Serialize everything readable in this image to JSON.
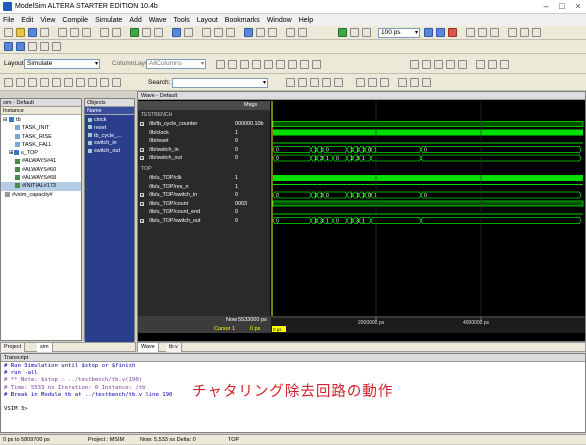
{
  "window": {
    "title": "ModelSim ALTERA STARTER EDITION 10.4b"
  },
  "menu": [
    "File",
    "Edit",
    "View",
    "Compile",
    "Simulate",
    "Add",
    "Wave",
    "Tools",
    "Layout",
    "Bookmarks",
    "Window",
    "Help"
  ],
  "toolbar": {
    "layout_label": "Layout",
    "layout_value": "Simulate",
    "column_layout_label": "ColumnLayout",
    "column_layout_value": "AllColumns",
    "search_label": "Search:",
    "run_length": "100 ps"
  },
  "instance_panel": {
    "title": "sim - Default",
    "column": "Instance",
    "rows": [
      "tb",
      "TASK_INIT",
      "TASK_RISE",
      "TASK_FALL",
      "u_TOP",
      "#ALWAYS#41",
      "#ALWAYS#60",
      "#ALWAYS#68",
      "#INITIAL#173",
      "#vsim_capacity#"
    ]
  },
  "objects_panel": {
    "title": "Objects",
    "column": "Name",
    "items": [
      "clock",
      "reset",
      "tb_cycle_...",
      "switch_in",
      "switch_out"
    ]
  },
  "wave": {
    "title": "Wave - Default",
    "msgs_header": "Msgs",
    "groups": [
      "TESTBENCH",
      "TOP"
    ],
    "signals": [
      {
        "name": "/tb/tb_cycle_counter",
        "value": "000000.10b"
      },
      {
        "name": "/tb/clock",
        "value": "1"
      },
      {
        "name": "/tb/reset",
        "value": "0"
      },
      {
        "name": "/tb/switch_in",
        "value": "0"
      },
      {
        "name": "/tb/switch_out",
        "value": "0"
      },
      {
        "name": "/tb/u_TOP/clk",
        "value": "1"
      },
      {
        "name": "/tb/u_TOP/res_n",
        "value": "1"
      },
      {
        "name": "/tb/u_TOP/switch_in",
        "value": "0"
      },
      {
        "name": "/tb/u_TOP/count",
        "value": "0003"
      },
      {
        "name": "/tb/u_TOP/count_end",
        "value": "0"
      },
      {
        "name": "/tb/u_TOP/switch_out",
        "value": "0"
      }
    ],
    "bus_values": {
      "switch_in": [
        "0",
        "1",
        "1",
        "0",
        "1",
        "1",
        "1",
        "0",
        "1",
        "0"
      ],
      "switch_out": [
        "0",
        "1",
        "3",
        "1",
        "0",
        "1",
        "3",
        "1"
      ],
      "count": [
        "0",
        "1",
        "3",
        "1",
        "3",
        "1",
        "3"
      ]
    },
    "now_label": "Now",
    "now_value": "5533000 ps",
    "cursor_label": "Cursor 1",
    "cursor_value": "0 ps",
    "cursor_marker": "0 ps",
    "ticks": [
      "2000000 ps",
      "4000000 ps"
    ],
    "tabs": [
      "Wave",
      "tb.v"
    ]
  },
  "left_tabs": [
    "Project",
    "sim"
  ],
  "transcript": {
    "title": "Transcript",
    "lines": [
      "# Run Simulation until $stop or $finish",
      "# run -all",
      "# ** Note: $stop    : ../testbench/tb.v(190)",
      "#    Time: 5533 ns  Iteration: 0  Instance: /tb",
      "# Break in Module tb at ../testbench/tb.v line 190",
      "",
      "VSIM 3>"
    ],
    "caption": "チャタリング除去回路の動作"
  },
  "status": {
    "range": "0 ps to 5809700 ps",
    "project": "Project : MSIM",
    "now": "Now: 5,533 ns  Delta: 0",
    "context": "TOP"
  },
  "colors": {
    "wave_green": "#00e000",
    "background": "#d4d0c8",
    "objects_bg": "#2b3e8c",
    "caption_red": "#d3202a"
  }
}
